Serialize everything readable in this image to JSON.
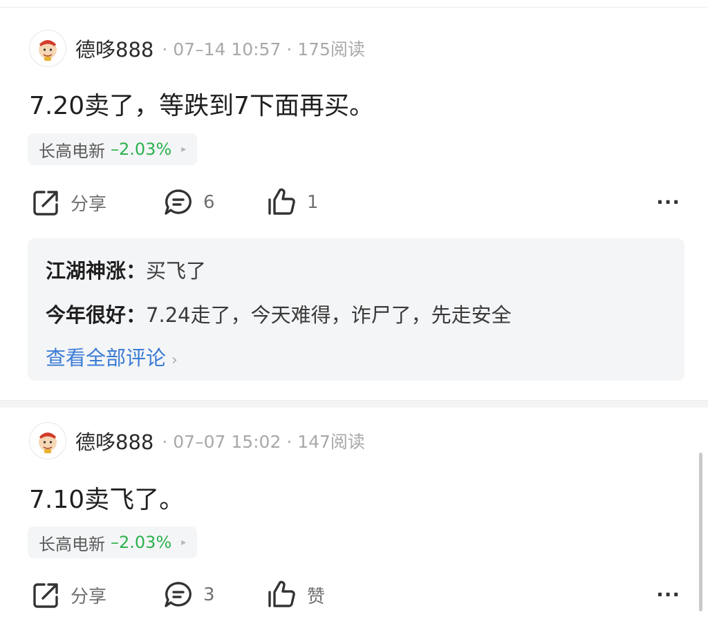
{
  "posts": [
    {
      "author": "德哆888",
      "meta": "· 07–14 10:57 · 175阅读",
      "text": "7.20卖了，等跌到7下面再买。",
      "stock": {
        "name": "长高电新",
        "change": "–2.03%",
        "arrow": "▸"
      },
      "actions": {
        "share_label": "分享",
        "comment_count": "6",
        "like_label": "1",
        "more": "···"
      },
      "comments": [
        {
          "user": "江湖神涨",
          "colon": "：",
          "text": "买飞了"
        },
        {
          "user": "今年很好",
          "colon": "：",
          "text": "7.24走了，今天难得，诈尸了，先走安全"
        }
      ],
      "see_all": "查看全部评论",
      "see_all_chevron": "›"
    },
    {
      "author": "德哆888",
      "meta": "· 07–07 15:02 · 147阅读",
      "text": "7.10卖飞了。",
      "stock": {
        "name": "长高电新",
        "change": "–2.03%",
        "arrow": "▸"
      },
      "actions": {
        "share_label": "分享",
        "comment_count": "3",
        "like_label": "赞",
        "more": "···"
      }
    }
  ],
  "colors": {
    "down": "#2bb24c",
    "link": "#3a7bd5",
    "meta": "#a8a8a8"
  },
  "icons": [
    "avatar-icon",
    "share-icon",
    "comment-icon",
    "like-icon",
    "more-icon"
  ]
}
